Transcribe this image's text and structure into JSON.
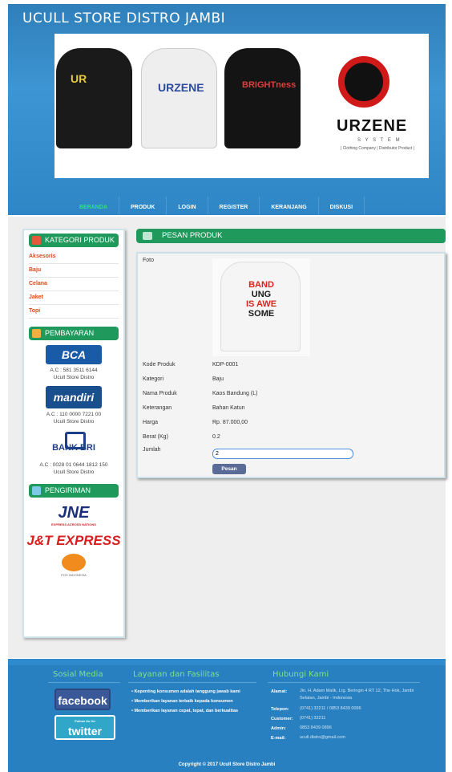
{
  "header": {
    "site_title": "UCULL STORE DISTRO JAMBI",
    "banner": {
      "shirt_1_print": "UR",
      "shirt_2_print": "URZENE",
      "shirt_3_print": "BRIGHTness",
      "brand_logo_text": "URZENE",
      "brand_sub": "S Y S T E M",
      "brand_tagline": "| Clothing Company | Distributor Product |",
      "slide_count": 5,
      "active_slide": 1
    },
    "nav": [
      "BERANDA",
      "PRODUK",
      "LOGIN",
      "REGISTER",
      "KERANJANG",
      "DISKUSI"
    ],
    "nav_active": "BERANDA"
  },
  "sidebar": {
    "categories_title": "KATEGORI PRODUK",
    "categories": [
      "Aksesoris",
      "Baju",
      "Celana",
      "Jaket",
      "Topi"
    ],
    "payment_title": "PEMBAYARAN",
    "payments": [
      {
        "bank": "BCA",
        "account": "A.C : 581 3511 6144",
        "holder": "Ucull Store Distro"
      },
      {
        "bank": "mandiri",
        "account": "A.C : 110 0000 7221 00",
        "holder": "Ucull Store Distro"
      },
      {
        "bank": "BANK BRI",
        "account": "A.C : 0028 01 0644 1812 150",
        "holder": "Ucull Store Distro"
      }
    ],
    "shipping_title": "PENGIRIMAN",
    "shipping": {
      "jne": "JNE",
      "jne_sub": "EXPRESS ACROSS NATIONS",
      "jt": "J&T EXPRESS",
      "pos": "POS INDONESIA"
    }
  },
  "content": {
    "title": "PESAN PRODUK",
    "labels": {
      "foto": "Foto",
      "kode": "Kode Produk",
      "kategori": "Kategori",
      "nama": "Nama Produk",
      "keterangan": "Keterangan",
      "harga": "Harga",
      "berat": "Berat (Kg)",
      "jumlah": "Jumlah"
    },
    "product": {
      "image_text_1": "BAND",
      "image_text_2": "UNG",
      "image_text_3": "IS AWE",
      "image_text_4": "SOME",
      "kode": "KDP-0001",
      "kategori": "Baju",
      "nama": "Kaos Bandung (L)",
      "keterangan": "Bahan Katun",
      "harga": "Rp. 87.000,00",
      "berat": "0.2",
      "jumlah": "2"
    },
    "order_button": "Pesan"
  },
  "footer": {
    "social_title": "Sosial Media",
    "facebook": "facebook",
    "twitter": "twitter",
    "twitter_small": "Follow Us On",
    "services_title": "Layanan dan Fasilitas",
    "services": [
      "• Kepenting konsumen adalah tanggung jawab kami",
      "• Memberikan layanan terbaik kepada konsumen",
      "• Memberikan layanan cepat, tepat, dan berkualitas"
    ],
    "contact_title": "Hubungi Kami",
    "contact": [
      {
        "k": "Alamat:",
        "v": "Jln. H. Adam Malik, Lrg. Beringin 4 RT 12, The Hok, Jambi Selatan, Jambi - Indonesia"
      },
      {
        "k": "Telepon:",
        "v": "(0741) 32211 / 0853 8439 0096"
      },
      {
        "k": "Customer:",
        "v": "(0741) 32211"
      },
      {
        "k": "Admin:",
        "v": "0853 8439 0896"
      },
      {
        "k": "E-mail:",
        "v": "ucull.distro@gmail.com"
      }
    ],
    "copyright": "Copyright © 2017 Ucull Store Distro Jambi"
  },
  "colors": {
    "header_blue": "#3d95d2",
    "nav_active": "#2ee082",
    "section_green": "#1f9a5c",
    "category_orange": "#e0461b",
    "footer_blue": "#2980c1",
    "footer_heading": "#7ee08a"
  }
}
